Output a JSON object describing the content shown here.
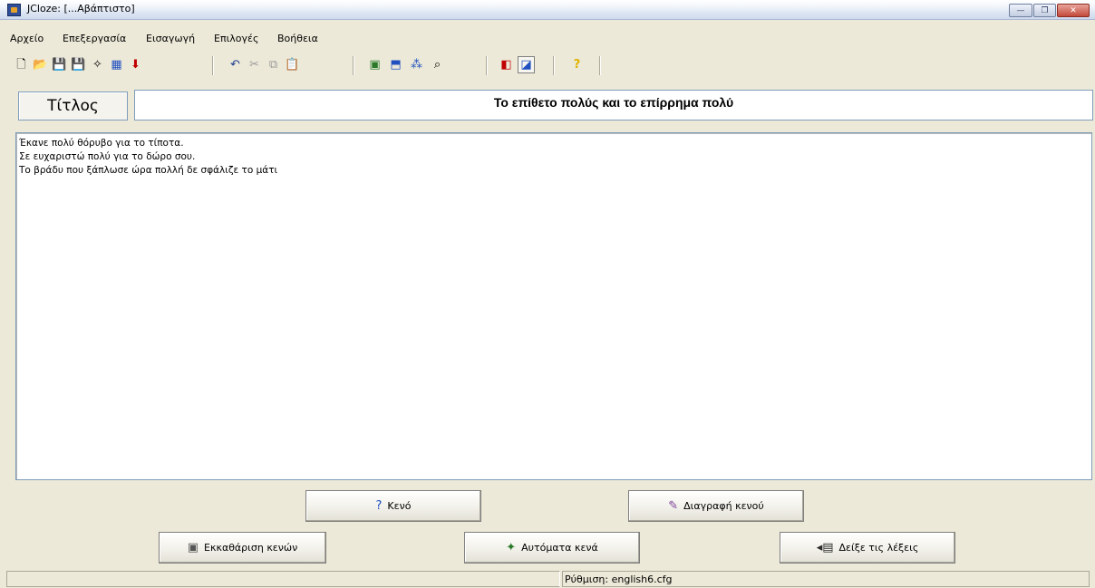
{
  "window": {
    "title": "JCloze: [...Αβάπτιστο]",
    "controls": {
      "minimize": "—",
      "maximize": "❐",
      "close": "✕"
    }
  },
  "menu": [
    "Αρχείο",
    "Επεξεργασία",
    "Εισαγωγή",
    "Επιλογές",
    "Βοήθεια"
  ],
  "toolbar": {
    "icons": [
      "new-file-icon",
      "open-folder-icon",
      "save-icon",
      "save-as-icon",
      "check-icon",
      "web-page-icon",
      "download-icon",
      "undo-icon",
      "cut-icon",
      "copy-icon",
      "paste-icon",
      "gap-settings-icon",
      "export-icon",
      "generate-gaps-icon",
      "find-icon",
      "config-icon",
      "window-icon",
      "help-icon"
    ],
    "glyphs": {
      "new": "🗋",
      "open": "📂",
      "save": "💾",
      "save_as": "💾",
      "check": "✧",
      "web": "▦",
      "download": "⬇",
      "undo": "↶",
      "cut": "✂",
      "copy": "⧉",
      "paste": "📋",
      "gap_settings": "▣",
      "export": "⬒",
      "generate": "⁂",
      "find": "⌕",
      "config": "◧",
      "window": "◪",
      "help": "?"
    }
  },
  "title_section": {
    "label": "Τίτλος",
    "value": "Το επίθετο πολύς και το επίρρημα πολύ"
  },
  "editor": {
    "lines": [
      "Έκανε πολύ θόρυβο για το τίποτα.",
      "Σε ευχαριστώ πολύ για το δώρο σου.",
      "Το βράδυ που ξάπλωσε ώρα πολλή δε σφάλιζε το μάτι"
    ]
  },
  "buttons": {
    "gap": {
      "label": "Κενό",
      "icon": "?"
    },
    "delete_gap": {
      "label": "Διαγραφή κενού",
      "icon": "✎"
    },
    "clear_gaps": {
      "label": "Εκκαθάριση κενών",
      "icon": "▣"
    },
    "auto_gaps": {
      "label": "Αυτόματα κενά",
      "icon": "✦"
    },
    "show_words": {
      "label": "Δείξε τις λέξεις",
      "icon": "◂▤"
    }
  },
  "status": {
    "config": "Ρύθμιση: english6.cfg"
  },
  "colors": {
    "help_icon": "#e0b400",
    "download_icon": "#c00000",
    "gap_icon": "#2050c0",
    "accent_blue": "#2e4e9a"
  }
}
